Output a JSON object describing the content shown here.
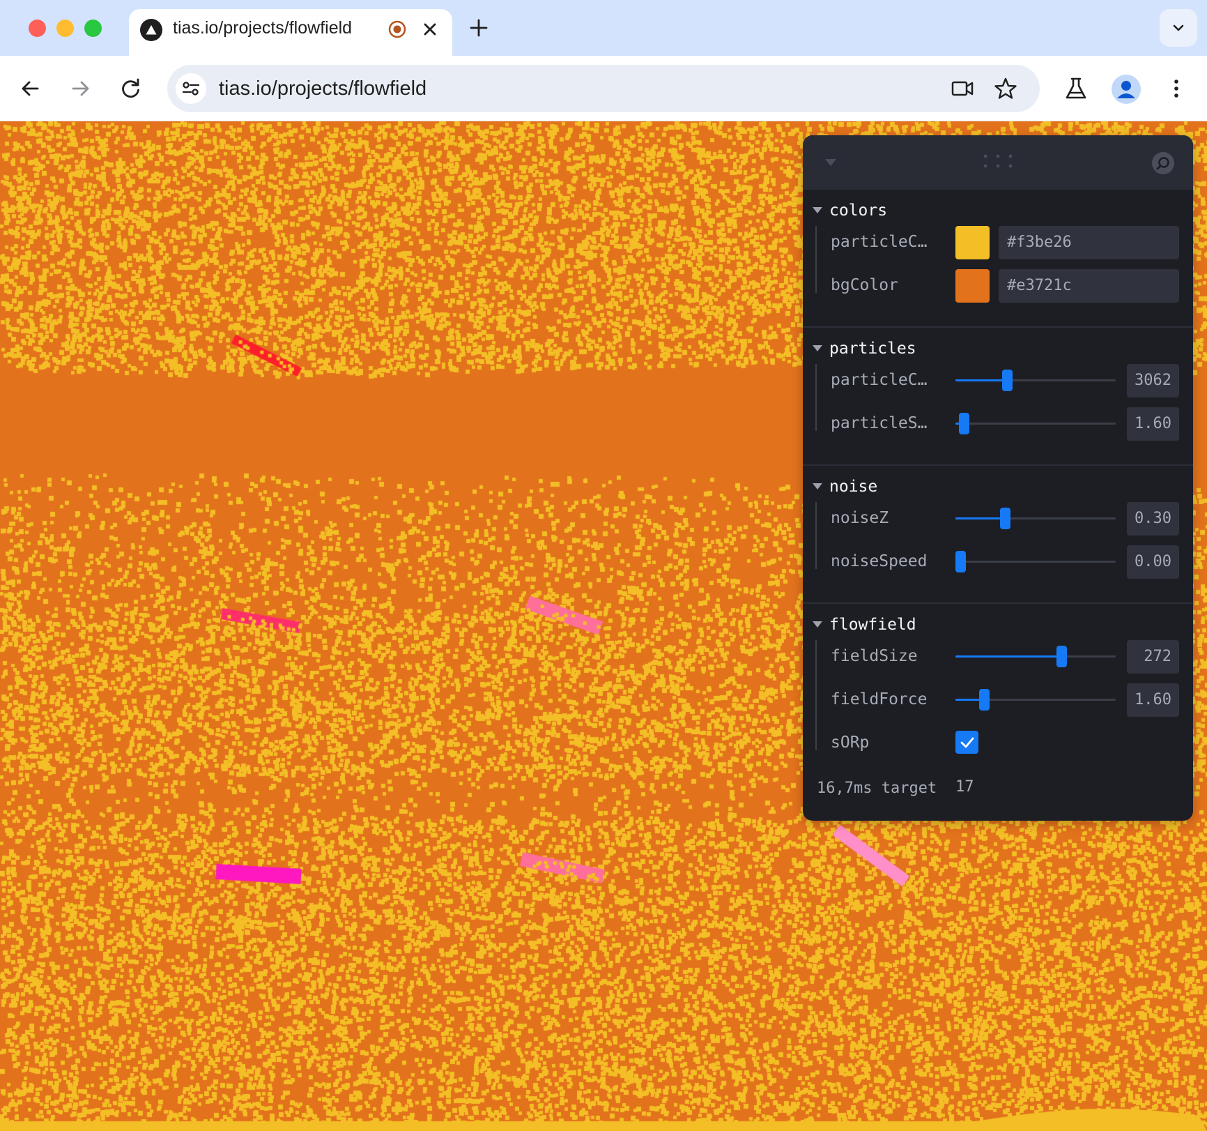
{
  "browser": {
    "tab_title": "tias.io/projects/flowfield",
    "url": "tias.io/projects/flowfield",
    "favicon_icon": "triangle-logo-icon"
  },
  "canvas": {
    "background_color": "#e3721c",
    "particle_color": "#f3be26",
    "trail_colors": [
      "#ff1f2a",
      "#ff2f6a",
      "#ff6f9a",
      "#ff17c0",
      "#ff8fc8"
    ]
  },
  "panel": {
    "folders": {
      "colors": {
        "title": "colors",
        "rows": [
          {
            "label": "particleC…",
            "value": "#f3be26",
            "swatch": "#f3be26"
          },
          {
            "label": "bgColor",
            "value": "#e3721c",
            "swatch": "#e3721c"
          }
        ]
      },
      "particles": {
        "title": "particles",
        "rows": [
          {
            "label": "particleC…",
            "value": "3062",
            "fraction": 0.32
          },
          {
            "label": "particleS…",
            "value": "1.60",
            "fraction": 0.05
          }
        ]
      },
      "noise": {
        "title": "noise",
        "rows": [
          {
            "label": "noiseZ",
            "value": "0.30",
            "fraction": 0.31
          },
          {
            "label": "noiseSpeed",
            "value": "0.00",
            "fraction": 0.03
          }
        ]
      },
      "flowfield": {
        "title": "flowfield",
        "rows": [
          {
            "label": "fieldSize",
            "value": "272",
            "fraction": 0.66
          },
          {
            "label": "fieldForce",
            "value": "1.60",
            "fraction": 0.18
          }
        ],
        "checkbox": {
          "label": "sORp",
          "checked": true
        }
      }
    },
    "monitor": {
      "label": "16,7ms target",
      "value": "17"
    }
  }
}
